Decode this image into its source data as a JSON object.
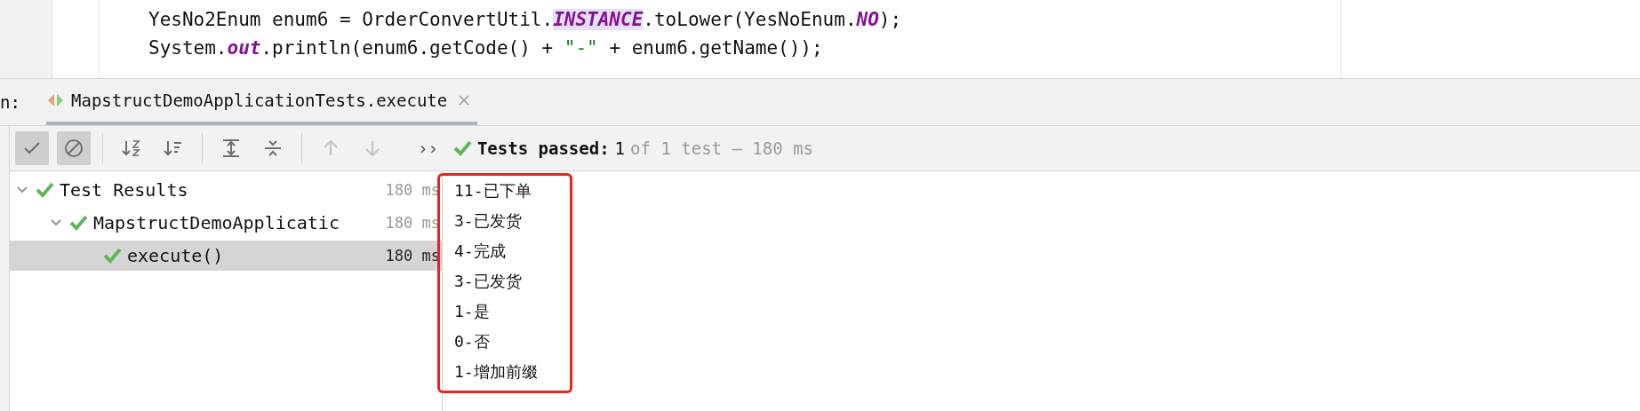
{
  "editor": {
    "lines": [
      [
        {
          "text": "YesNo2Enum enum6 = OrderConvertUtil.",
          "kind": "plain"
        },
        {
          "text": "INSTANCE",
          "kind": "static-highlight"
        },
        {
          "text": ".toLower(YesNoEnum.",
          "kind": "plain"
        },
        {
          "text": "NO",
          "kind": "static"
        },
        {
          "text": ");",
          "kind": "plain"
        }
      ],
      [
        {
          "text": "System.",
          "kind": "plain"
        },
        {
          "text": "out",
          "kind": "static"
        },
        {
          "text": ".println(enum6.getCode() + ",
          "kind": "plain"
        },
        {
          "text": "\"-\"",
          "kind": "string"
        },
        {
          "text": " + enum6.getName());",
          "kind": "plain"
        }
      ]
    ]
  },
  "run_panel": {
    "label": "n:",
    "tabs": [
      {
        "label": "MapstructDemoApplicationTests.execute",
        "selected": true
      }
    ]
  },
  "toolbar": {
    "buttons": [
      {
        "kind": "check",
        "selected": true,
        "disabled": false
      },
      {
        "kind": "stop",
        "selected": true,
        "disabled": false
      },
      {
        "kind": "divider"
      },
      {
        "kind": "sort-alpha",
        "selected": false,
        "disabled": false
      },
      {
        "kind": "sort-duration",
        "selected": false,
        "disabled": false
      },
      {
        "kind": "divider"
      },
      {
        "kind": "expand",
        "selected": false,
        "disabled": false
      },
      {
        "kind": "collapse",
        "selected": false,
        "disabled": false
      },
      {
        "kind": "divider"
      },
      {
        "kind": "up",
        "selected": false,
        "disabled": true
      },
      {
        "kind": "down",
        "selected": false,
        "disabled": true
      }
    ],
    "more": "››",
    "status": {
      "label": "Tests passed:",
      "count": "1",
      "detail": "of 1 test – 180 ms"
    }
  },
  "tree": [
    {
      "label": "Test Results",
      "time": "180 ms",
      "passed": true,
      "expanded": true,
      "selected": false,
      "children": [
        {
          "label": "MapstructDemoApplicatic",
          "time": "180 ms",
          "passed": true,
          "expanded": true,
          "selected": false,
          "children": [
            {
              "label": "execute()",
              "time": "180 ms",
              "passed": true,
              "selected": true
            }
          ]
        }
      ]
    }
  ],
  "console": {
    "lines": [
      "11-已下单",
      "3-已发货",
      "4-完成",
      "3-已发货",
      "1-是",
      "0-否",
      "1-增加前缀"
    ],
    "highlighted": true
  }
}
